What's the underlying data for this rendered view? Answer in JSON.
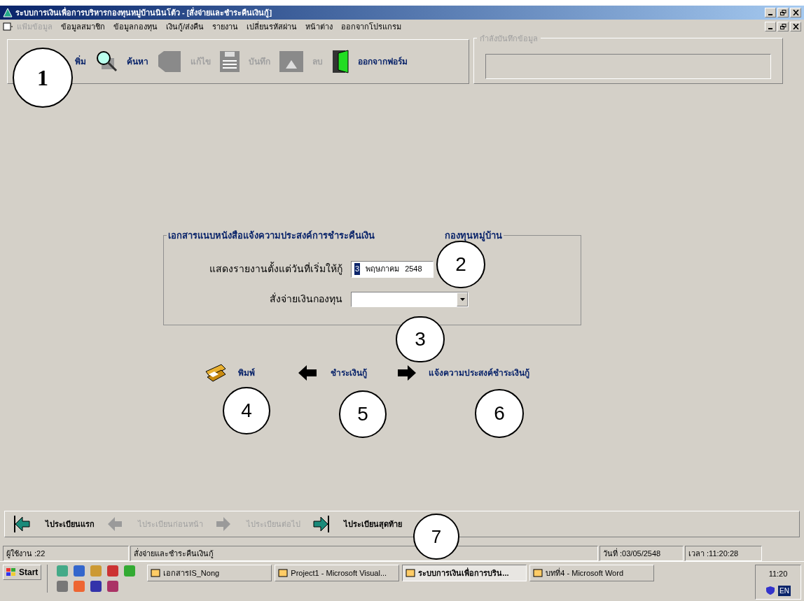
{
  "window": {
    "title": "ระบบการเงินเพื่อการบริหารกองทุนหมู่บ้านนินโต้ว - [สั่งจ่ายและชำระคืนเงินกู้]"
  },
  "menu": [
    {
      "label": "แฟ้มข้อมูล",
      "disabled": true
    },
    {
      "label": "ข้อมูลสมาชิก",
      "disabled": false
    },
    {
      "label": "ข้อมูลกองทุน",
      "disabled": false
    },
    {
      "label": "เงินกู้/ส่งคืน",
      "disabled": false
    },
    {
      "label": "รายงาน",
      "disabled": false
    },
    {
      "label": "เปลี่ยนรหัสผ่าน",
      "disabled": false
    },
    {
      "label": "หน้าต่าง",
      "disabled": false
    },
    {
      "label": "ออกจากโปรแกรม",
      "disabled": false
    }
  ],
  "toolbar": [
    {
      "kind": "add",
      "label": "พิ่ม",
      "disabled": false
    },
    {
      "kind": "search",
      "label": "ค้นหา",
      "disabled": false
    },
    {
      "kind": "edit",
      "label": "แก้ไข",
      "disabled": true
    },
    {
      "kind": "save",
      "label": "บันทึก",
      "disabled": true
    },
    {
      "kind": "delete",
      "label": "ลบ",
      "disabled": true
    },
    {
      "kind": "exit",
      "label": "ออกจากฟอร์ม",
      "disabled": false
    }
  ],
  "saving_panel": {
    "title": "กำลังบันทึกข้อมูล"
  },
  "form": {
    "heading_start": "เอกสารแนบหนังสือแจ้งความประสงค์การชำระคืนเงิน",
    "heading_end": "กองทุนหมู่บ้าน",
    "date_label": "แสดงรายงานตั้งแต่วันที่เริ่มให้กู้",
    "date_day": "3",
    "date_month": "พฤษภาคม",
    "date_year": "2548",
    "fund_label": "สั่งจ่ายเงินกองทุน"
  },
  "actions": [
    {
      "kind": "print",
      "label": "พิมพ์"
    },
    {
      "kind": "back",
      "label": "ชำระเงินกู้"
    },
    {
      "kind": "forward",
      "label": "แจ้งความประสงค์ชำระเงินกู้"
    }
  ],
  "record_nav": [
    {
      "kind": "first",
      "label": "ไประเบียนแรก",
      "disabled": false
    },
    {
      "kind": "prev",
      "label": "ไประเบียนก่อนหน้า",
      "disabled": true
    },
    {
      "kind": "next",
      "label": "ไประเบียนต่อไป",
      "disabled": true
    },
    {
      "kind": "last",
      "label": "ไประเบียนสุดท้าย",
      "disabled": false
    }
  ],
  "status_bar": [
    "ผู้ใช้งาน :22",
    "สั่งจ่ายและชำระคืนเงินกู้",
    "วันที่ :03/05/2548",
    "เวลา :11:20:28"
  ],
  "taskbar": {
    "start": "Start",
    "tasks": [
      {
        "label": "เอกสารIS_Nong",
        "selected": false
      },
      {
        "label": "Project1 - Microsoft Visual...",
        "selected": false
      },
      {
        "label": "ระบบการเงินเพื่อการบริน...",
        "selected": true
      },
      {
        "label": "บทที่4 - Microsoft Word",
        "selected": false
      }
    ],
    "clock": "11:20",
    "language": "EN"
  },
  "callouts": [
    "1",
    "2",
    "3",
    "4",
    "5",
    "6",
    "7"
  ]
}
